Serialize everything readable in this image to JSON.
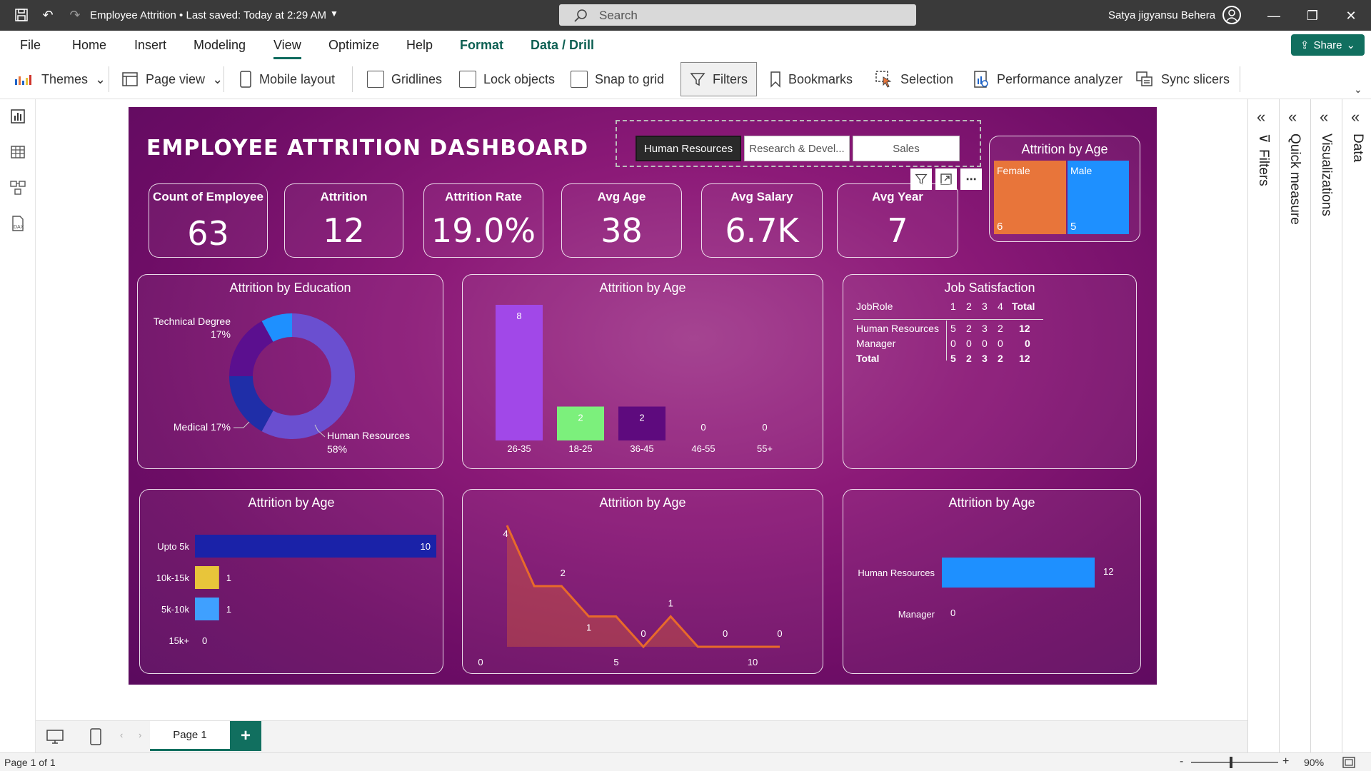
{
  "window": {
    "title": "Employee Attrition  •  Last saved: Today at 2:29 AM",
    "search_placeholder": "Search",
    "user_name": "Satya jigyansu Behera"
  },
  "menu": {
    "tabs": [
      "File",
      "Home",
      "Insert",
      "Modeling",
      "View",
      "Optimize",
      "Help",
      "Format",
      "Data / Drill"
    ],
    "active": "View",
    "share_label": "Share"
  },
  "ribbon": {
    "themes": "Themes",
    "page_view": "Page view",
    "mobile_layout": "Mobile layout",
    "gridlines": "Gridlines",
    "lock_objects": "Lock objects",
    "snap_to_grid": "Snap to grid",
    "filters": "Filters",
    "bookmarks": "Bookmarks",
    "selection": "Selection",
    "performance_analyzer": "Performance analyzer",
    "sync_slicers": "Sync slicers"
  },
  "panes": {
    "filters": "Filters",
    "quick_measure": "Quick measure",
    "visualizations": "Visualizations",
    "data": "Data"
  },
  "dashboard": {
    "title": "EMPLOYEE ATTRITION DASHBOARD",
    "slicer": [
      "Human Resources",
      "Research & Devel...",
      "Sales"
    ],
    "slicer_selected": "Human Resources",
    "kpis": [
      {
        "label": "Count of Employee",
        "value": "63"
      },
      {
        "label": "Attrition",
        "value": "12"
      },
      {
        "label": "Attrition Rate",
        "value": "19.0%"
      },
      {
        "label": "Avg Age",
        "value": "38"
      },
      {
        "label": "Avg Salary",
        "value": "6.7K"
      },
      {
        "label": "Avg Year",
        "value": "7"
      }
    ],
    "gender": {
      "title": "Attrition by Age",
      "female_label": "Female",
      "female_value": "6",
      "male_label": "Male",
      "male_value": "5",
      "female_color": "#e8753a",
      "male_color": "#1e90ff"
    },
    "matrix": {
      "title": "Job Satisfaction",
      "columns": [
        "JobRole",
        "1",
        "2",
        "3",
        "4",
        "Total"
      ],
      "rows": [
        [
          "Human Resources",
          "5",
          "2",
          "3",
          "2",
          "12"
        ],
        [
          "Manager",
          "0",
          "0",
          "0",
          "0",
          "0"
        ],
        [
          "Total",
          "5",
          "2",
          "3",
          "2",
          "12"
        ]
      ]
    }
  },
  "chart_data": [
    {
      "type": "pie",
      "title": "Attrition by Education",
      "slices": [
        {
          "name": "Human Resources",
          "pct": 58,
          "label": "Human Resources 58%",
          "color": "#6a4fd0"
        },
        {
          "name": "Medical",
          "pct": 17,
          "label": "Medical 17%",
          "color": "#1f2ea8"
        },
        {
          "name": "Technical Degree",
          "pct": 17,
          "label": "Technical Degree 17%",
          "color": "#5b0f8f"
        },
        {
          "name": "Other",
          "pct": 8,
          "label": "",
          "color": "#1e90ff"
        }
      ]
    },
    {
      "type": "bar",
      "title": "Attrition by Age",
      "categories": [
        "26-35",
        "18-25",
        "36-45",
        "46-55",
        "55+"
      ],
      "values": [
        8,
        2,
        2,
        0,
        0
      ],
      "colors": [
        "#a148e8",
        "#7cf07c",
        "#5e0a7e",
        "#888888",
        "#888888"
      ],
      "ylim": [
        0,
        8
      ]
    },
    {
      "type": "bar",
      "orientation": "horizontal",
      "title": "Attrition by Age",
      "categories": [
        "Upto 5k",
        "10k-15k",
        "5k-10k",
        "15k+"
      ],
      "values": [
        10,
        1,
        1,
        0
      ],
      "colors": [
        "#1a22a8",
        "#e8c53a",
        "#3fa0ff",
        "#888888"
      ]
    },
    {
      "type": "area",
      "title": "Attrition by Age",
      "x": [
        1,
        2,
        3,
        4,
        5,
        6,
        7,
        8,
        9,
        10,
        11
      ],
      "values": [
        4,
        2,
        2,
        1,
        1,
        0,
        1,
        0,
        0,
        0,
        0
      ],
      "point_labels": [
        "4",
        "2",
        "",
        "1",
        "",
        "0",
        "1",
        "",
        "0",
        "",
        "0"
      ],
      "x_ticks": [
        "0",
        "5",
        "10"
      ],
      "color": "#e86a2a"
    },
    {
      "type": "bar",
      "orientation": "horizontal",
      "title": "Attrition by Age",
      "categories": [
        "Human Resources",
        "Manager"
      ],
      "values": [
        12,
        0
      ],
      "colors": [
        "#1e90ff",
        "#888888"
      ]
    }
  ],
  "pages": {
    "tab": "Page 1",
    "status": "Page 1 of 1",
    "zoom": "90%"
  }
}
